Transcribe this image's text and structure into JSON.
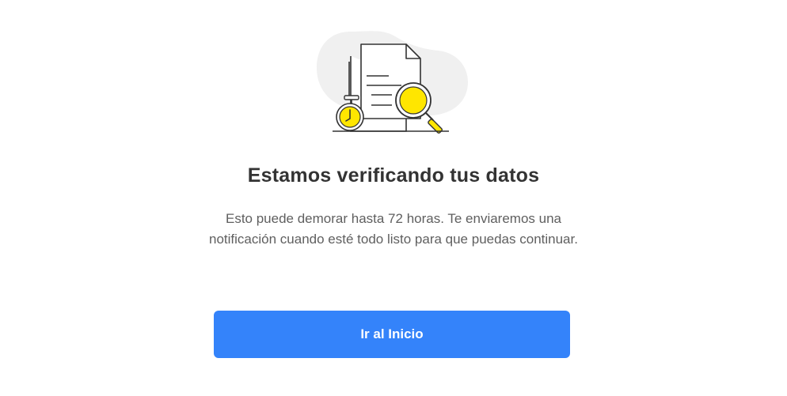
{
  "illustration": {
    "icons": [
      "document-icon",
      "magnifier-icon",
      "stopwatch-icon"
    ],
    "colors": {
      "accent_yellow": "#ffe600",
      "stroke": "#333333",
      "blob_bg": "#f0f0f0"
    }
  },
  "verification": {
    "title": "Estamos verificando tus datos",
    "line1": "Esto puede demorar hasta 72 horas. Te enviaremos una",
    "line2": "notificación cuando esté todo listo para que puedas continuar."
  },
  "actions": {
    "home_button_label": "Ir al Inicio",
    "button_color": "#3483fa"
  }
}
